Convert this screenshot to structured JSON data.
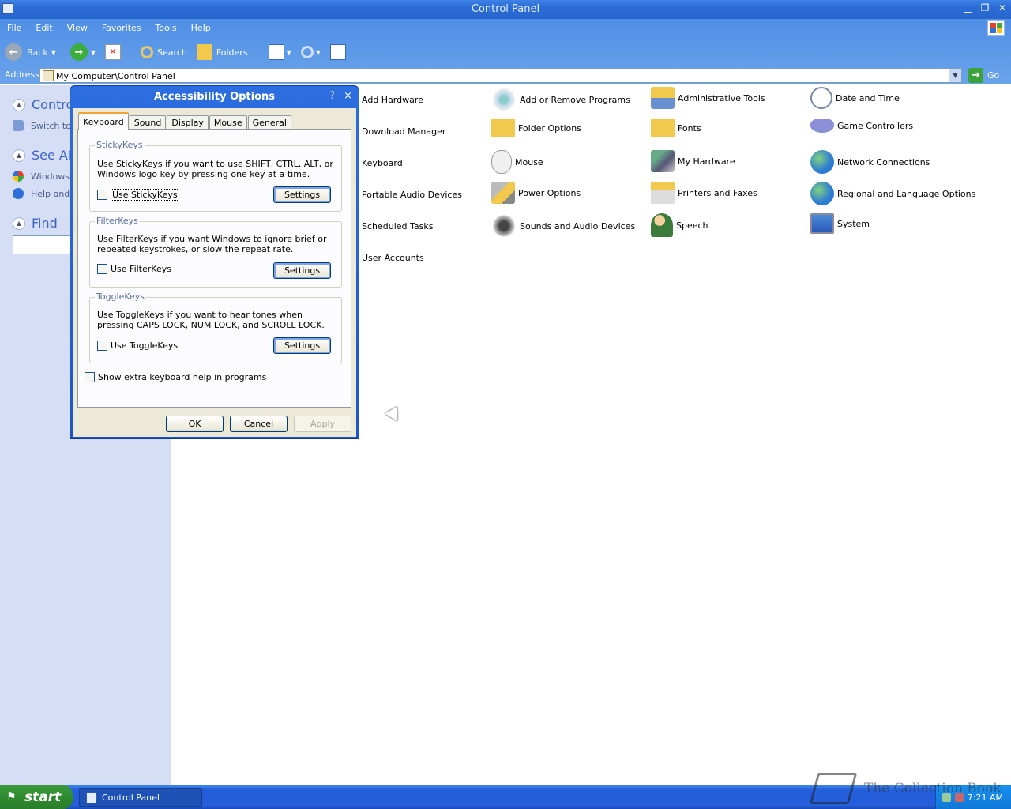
{
  "window": {
    "title": "Control Panel"
  },
  "menu": [
    "File",
    "Edit",
    "View",
    "Favorites",
    "Tools",
    "Help"
  ],
  "toolbar": {
    "back": "Back",
    "search": "Search",
    "folders": "Folders"
  },
  "address": {
    "label": "Address",
    "value": "My Computer\\Control Panel",
    "go": "Go"
  },
  "leftpane": {
    "control_header": "Contro",
    "switch_text": "Switch to",
    "see_also_header": "See Al",
    "windows_text": "Windows",
    "help_text": "Help and",
    "find_header": "Find"
  },
  "items": [
    {
      "label": "Add Hardware",
      "icon": "add-hardware-icon"
    },
    {
      "label": "Add or Remove Programs",
      "icon": "add-remove-programs-icon"
    },
    {
      "label": "Administrative Tools",
      "icon": "administrative-tools-icon"
    },
    {
      "label": "Date and Time",
      "icon": "date-time-icon"
    },
    {
      "label": "Download Manager",
      "icon": "download-manager-icon"
    },
    {
      "label": "Folder Options",
      "icon": "folder-options-icon"
    },
    {
      "label": "Fonts",
      "icon": "fonts-icon"
    },
    {
      "label": "Game Controllers",
      "icon": "game-controllers-icon"
    },
    {
      "label": "Keyboard",
      "icon": "keyboard-icon"
    },
    {
      "label": "Mouse",
      "icon": "mouse-icon"
    },
    {
      "label": "My Hardware",
      "icon": "my-hardware-icon"
    },
    {
      "label": "Network Connections",
      "icon": "network-connections-icon"
    },
    {
      "label": "Portable Audio Devices",
      "icon": "portable-audio-icon"
    },
    {
      "label": "Power Options",
      "icon": "power-options-icon"
    },
    {
      "label": "Printers and Faxes",
      "icon": "printers-faxes-icon"
    },
    {
      "label": "Regional and Language Options",
      "icon": "regional-language-icon"
    },
    {
      "label": "Scheduled Tasks",
      "icon": "scheduled-tasks-icon"
    },
    {
      "label": "Sounds and Audio Devices",
      "icon": "sounds-audio-icon"
    },
    {
      "label": "Speech",
      "icon": "speech-icon"
    },
    {
      "label": "System",
      "icon": "system-icon"
    },
    {
      "label": "User Accounts",
      "icon": "user-accounts-icon"
    }
  ],
  "dialog": {
    "title": "Accessibility Options",
    "help": "?",
    "close": "×",
    "tabs": [
      "Keyboard",
      "Sound",
      "Display",
      "Mouse",
      "General"
    ],
    "active_tab": "Keyboard",
    "sticky": {
      "title": "StickyKeys",
      "desc": "Use StickyKeys if you want to use SHIFT, CTRL, ALT, or Windows logo key by pressing one key at a time.",
      "checkbox": "Use StickyKeys",
      "checked": false,
      "button": "Settings"
    },
    "filter": {
      "title": "FilterKeys",
      "desc": "Use FilterKeys if you want Windows to ignore brief or repeated keystrokes, or slow the repeat rate.",
      "checkbox": "Use FilterKeys",
      "checked": false,
      "button": "Settings"
    },
    "toggle": {
      "title": "ToggleKeys",
      "desc": "Use ToggleKeys if you want to hear tones when pressing CAPS LOCK, NUM LOCK, and SCROLL LOCK.",
      "checkbox": "Use ToggleKeys",
      "checked": false,
      "button": "Settings"
    },
    "extra_help": "Show extra keyboard help in programs",
    "ok": "OK",
    "cancel": "Cancel",
    "apply": "Apply"
  },
  "taskbar": {
    "start": "start",
    "task": "Control Panel",
    "clock": "7:21 AM"
  },
  "watermark": "The Collection Book",
  "colors": {
    "title_blue": "#2766cc",
    "start_green": "#2f8a2f",
    "dialog_face": "#ece9d8",
    "left_pane": "#d5def4"
  }
}
